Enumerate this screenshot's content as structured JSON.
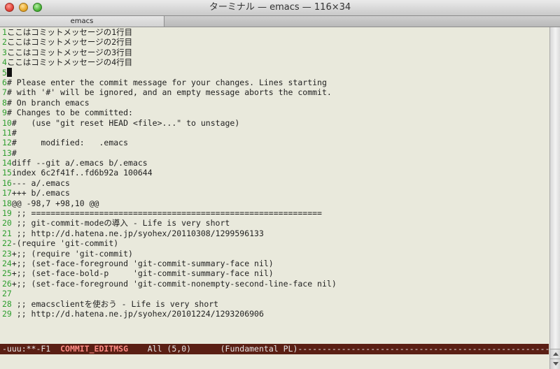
{
  "window": {
    "title": "ターミナル — emacs — 116×34",
    "tab_label": "emacs"
  },
  "editor": {
    "lines": [
      {
        "num": "1",
        "text": "ここはコミットメッセージの1行目"
      },
      {
        "num": "2",
        "text": "ここはコミットメッセージの2行目"
      },
      {
        "num": "3",
        "text": "ここはコミットメッセージの3行目"
      },
      {
        "num": "4",
        "text": "ここはコミットメッセージの4行目"
      },
      {
        "num": "5",
        "text": "",
        "cursor": true
      },
      {
        "num": "6",
        "text": "# Please enter the commit message for your changes. Lines starting"
      },
      {
        "num": "7",
        "text": "# with '#' will be ignored, and an empty message aborts the commit."
      },
      {
        "num": "8",
        "text": "# On branch emacs"
      },
      {
        "num": "9",
        "text": "# Changes to be committed:"
      },
      {
        "num": "10",
        "text": "#   (use \"git reset HEAD <file>...\" to unstage)"
      },
      {
        "num": "11",
        "text": "#"
      },
      {
        "num": "12",
        "text": "#\tmodified:   .emacs"
      },
      {
        "num": "13",
        "text": "#"
      },
      {
        "num": "14",
        "text": "diff --git a/.emacs b/.emacs"
      },
      {
        "num": "15",
        "text": "index 6c2f41f..fd6b92a 100644"
      },
      {
        "num": "16",
        "text": "--- a/.emacs"
      },
      {
        "num": "17",
        "text": "+++ b/.emacs"
      },
      {
        "num": "18",
        "text": "@@ -98,7 +98,10 @@"
      },
      {
        "num": "19",
        "text": " ;; ============================================================"
      },
      {
        "num": "20",
        "text": " ;; git-commit-modeの導入 - Life is very short"
      },
      {
        "num": "21",
        "text": " ;; http://d.hatena.ne.jp/syohex/20110308/1299596133"
      },
      {
        "num": "22",
        "text": "-(require 'git-commit)"
      },
      {
        "num": "23",
        "text": "+;; (require 'git-commit)"
      },
      {
        "num": "24",
        "text": "+;; (set-face-foreground 'git-commit-summary-face nil)"
      },
      {
        "num": "25",
        "text": "+;; (set-face-bold-p     'git-commit-summary-face nil)"
      },
      {
        "num": "26",
        "text": "+;; (set-face-foreground 'git-commit-nonempty-second-line-face nil)"
      },
      {
        "num": "27",
        "text": " "
      },
      {
        "num": "28",
        "text": " ;; emacsclientを使おう - Life is very short"
      },
      {
        "num": "29",
        "text": " ;; http://d.hatena.ne.jp/syohex/20101224/1293206906"
      }
    ]
  },
  "modeline": {
    "status": "-uuu:**-F1  ",
    "buffer_name": "COMMIT_EDITMSG",
    "position": "    All (5,0)      ",
    "mode": "(Fundamental PL)",
    "fill": "-------------------------------------------------------------------------------------------"
  },
  "colors": {
    "line_number": "#2f9e2f",
    "modeline_bg": "#5a1f14",
    "modeline_buffer": "#ff8a84",
    "editor_bg": "#e9e9dc"
  }
}
